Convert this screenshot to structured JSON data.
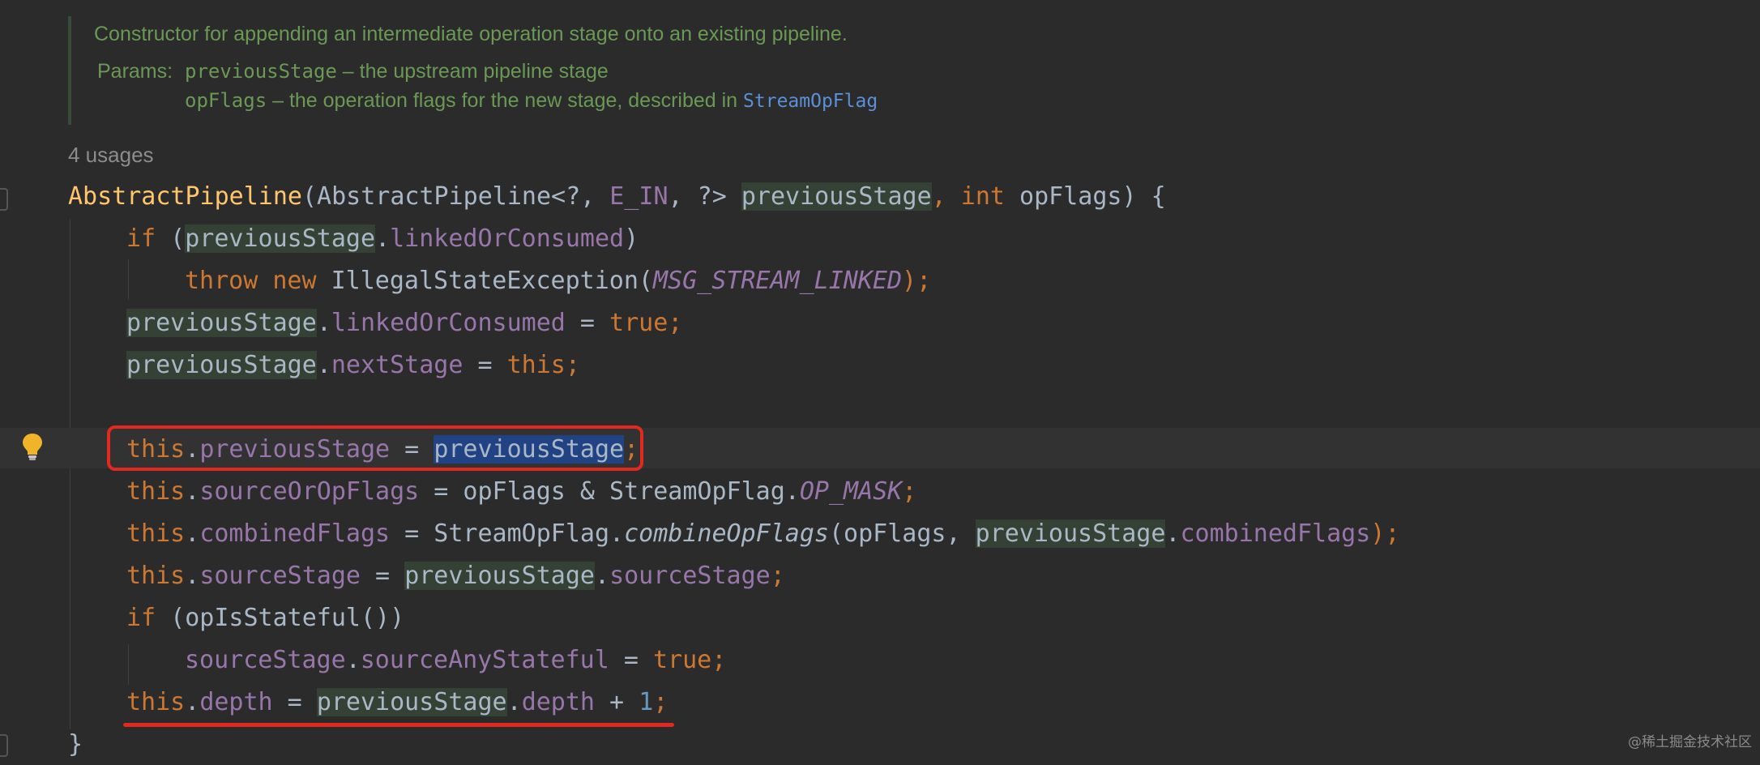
{
  "doc": {
    "summary": "Constructor for appending an intermediate operation stage onto an existing pipeline.",
    "params_label": "Params:",
    "params": [
      {
        "name": "previousStage",
        "desc": " – the upstream pipeline stage"
      },
      {
        "name": "opFlags",
        "desc": " – the operation flags for the new stage, described in ",
        "link": "StreamOpFlag"
      }
    ]
  },
  "usages": "4 usages",
  "code": {
    "l1": {
      "ctor": "AbstractPipeline",
      "p1": "(AbstractPipeline<?, ",
      "e_in": "E_IN",
      "p2": ", ?> ",
      "prev": "previousStage",
      "comma": ", ",
      "int": "int",
      "tail": " opFlags) {"
    },
    "l2": {
      "if": "if",
      "open": " (",
      "prev": "previousStage",
      "dot": ".",
      "field": "linkedOrConsumed",
      "close": ")"
    },
    "l3": {
      "throw": "throw",
      "sp": " ",
      "new": "new",
      "rest": " IllegalStateException(",
      "const": "MSG_STREAM_LINKED",
      "end": ");"
    },
    "l4": {
      "prev": "previousStage",
      "dot": ".",
      "field": "linkedOrConsumed",
      "eq": " = ",
      "val": "true",
      "semi": ";"
    },
    "l5": {
      "prev": "previousStage",
      "dot": ".",
      "field": "nextStage",
      "eq": " = ",
      "val": "this",
      "semi": ";"
    },
    "l6": {
      "this": "this",
      "dot": ".",
      "field": "previousStage",
      "eq": " = ",
      "prev": "previousStage",
      "semi": ";"
    },
    "l7": {
      "this": "this",
      "dot": ".",
      "field": "sourceOrOpFlags",
      "rest": " = opFlags & StreamOpFlag.",
      "const": "OP_MASK",
      "semi": ";"
    },
    "l8": {
      "this": "this",
      "dot": ".",
      "field": "combinedFlags",
      "mid": " = StreamOpFlag.",
      "method": "combineOpFlags",
      "args": "(opFlags, ",
      "prev": "previousStage",
      "dot2": ".",
      "field2": "combinedFlags",
      "end": ");"
    },
    "l9": {
      "this": "this",
      "dot": ".",
      "field": "sourceStage",
      "eq": " = ",
      "prev": "previousStage",
      "dot2": ".",
      "field2": "sourceStage",
      "semi": ";"
    },
    "l10": {
      "if": "if",
      "rest": " (opIsStateful())"
    },
    "l11": {
      "src": "sourceStage",
      "dot": ".",
      "field": "sourceAnyStateful",
      "eq": " = ",
      "val": "true",
      "semi": ";"
    },
    "l12": {
      "this": "this",
      "dot": ".",
      "field": "depth",
      "eq": " = ",
      "prev": "previousStage",
      "dot2": ".",
      "field2": "depth",
      "plus": " + ",
      "num": "1",
      "semi": ";"
    },
    "l13": {
      "brace": "}"
    }
  },
  "watermark": "@稀土掘金技术社区",
  "colors": {
    "background": "#2b2b2b",
    "keyword": "#cc7832",
    "field": "#9876aa",
    "method_decl": "#ffc66d",
    "doc_comment": "#6a9955",
    "usage_highlight": "#344134",
    "selection": "#214283",
    "annotation_red": "#e3281e"
  }
}
